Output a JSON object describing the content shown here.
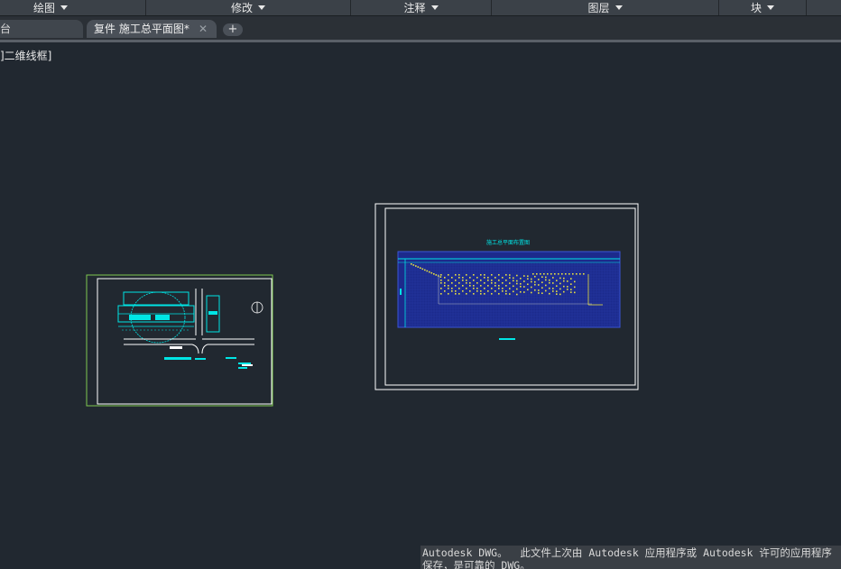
{
  "ribbon": {
    "panels": [
      "绘图",
      "修改",
      "注释",
      "图层",
      "块"
    ]
  },
  "tabs": {
    "inactive_label": "台",
    "active_label": "复件 施工总平面图*",
    "close_glyph": "✕",
    "new_tab_glyph": "+"
  },
  "viewport": {
    "label": "]二维线框]"
  },
  "drawing": {
    "sheet2_title": "施工总平面布置图",
    "colors": {
      "background": "#212830",
      "viewport_border": "#7ec850",
      "frame": "#ffffff",
      "cyan": "#00e5e5",
      "grid": "#1c2a8c",
      "yellow": "#e8e040"
    }
  },
  "notice": {
    "text": "Autodesk DWG。  此文件上次由 Autodesk 应用程序或 Autodesk 许可的应用程序保存，是可靠的 DWG。"
  }
}
